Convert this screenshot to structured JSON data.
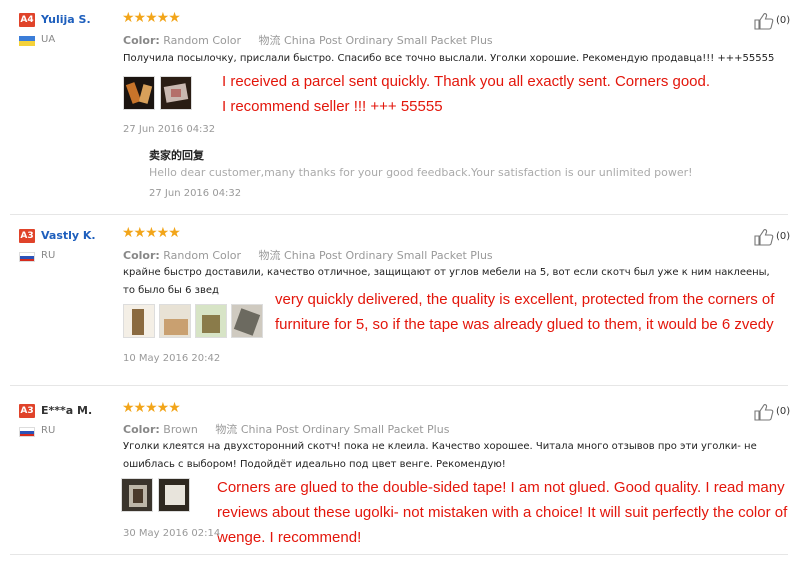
{
  "reviews": [
    {
      "level": "A4",
      "name": "Yulija S.",
      "name_style": "blue",
      "country": "UA",
      "flag_colors": [
        "#3b7dd8",
        "#f5d23a"
      ],
      "stars": "★★★★★",
      "rating": 5,
      "color_label": "Color:",
      "color_value": "Random Color",
      "logistics_label": "物流",
      "logistics_value": "China Post Ordinary Small Packet Plus",
      "text": "Получила посылочку, прислали быстро. Спасибо все точно выслали. Уголки хорошие. Рекомендую продавца!!! +++55555",
      "translation_lines": [
        "I received a parcel sent quickly. Thank you all exactly sent. Corners good.",
        "I recommend seller !!! +++ 55555"
      ],
      "date": "27 Jun 2016 04:32",
      "likes": "(0)",
      "reply": {
        "title": "卖家的回复",
        "text": "Hello dear customer,many thanks for your good feedback.Your satisfaction is our unlimited power!",
        "date": "27 Jun 2016 04:32"
      }
    },
    {
      "level": "A3",
      "name": "Vastly K.",
      "name_style": "blue",
      "country": "RU",
      "flag_colors": [
        "#ffffff",
        "#2b52b8",
        "#d52b1e"
      ],
      "stars": "★★★★★",
      "rating": 5,
      "color_label": "Color:",
      "color_value": "Random Color",
      "logistics_label": "物流",
      "logistics_value": "China Post Ordinary Small Packet Plus",
      "text": "крайне быстро доставили, качество отличное, защищают от углов мебели на 5, вот если скотч был уже к ним наклеены, то было бы 6 звед",
      "translation_lines": [
        "very quickly delivered, the quality is excellent, protected from the corners of",
        "furniture for 5, so if the tape was already glued to them, it would be 6 zvedy"
      ],
      "date": "10 May 2016 20:42",
      "likes": "(0)"
    },
    {
      "level": "A3",
      "name": "E***a M.",
      "name_style": "dark",
      "country": "RU",
      "flag_colors": [
        "#ffffff",
        "#2b52b8",
        "#d52b1e"
      ],
      "stars": "★★★★★",
      "rating": 5,
      "color_label": "Color:",
      "color_value": "Brown",
      "logistics_label": "物流",
      "logistics_value": "China Post Ordinary Small Packet Plus",
      "text": "Уголки клеятся на двухсторонний скотч! пока не клеила. Качество хорошее. Читала много отзывов про эти уголки- не ошиблась с выбором! Подойдёт идеально под цвет венге. Рекомендую!",
      "translation_lines": [
        "Corners are glued to the double-sided tape! I am not glued. Good quality. I read many",
        "reviews about these ugolki- not mistaken with a choice! It will suit perfectly the color of",
        "wenge. I recommend!"
      ],
      "date": "30 May 2016 02:14",
      "likes": "(0)"
    }
  ]
}
